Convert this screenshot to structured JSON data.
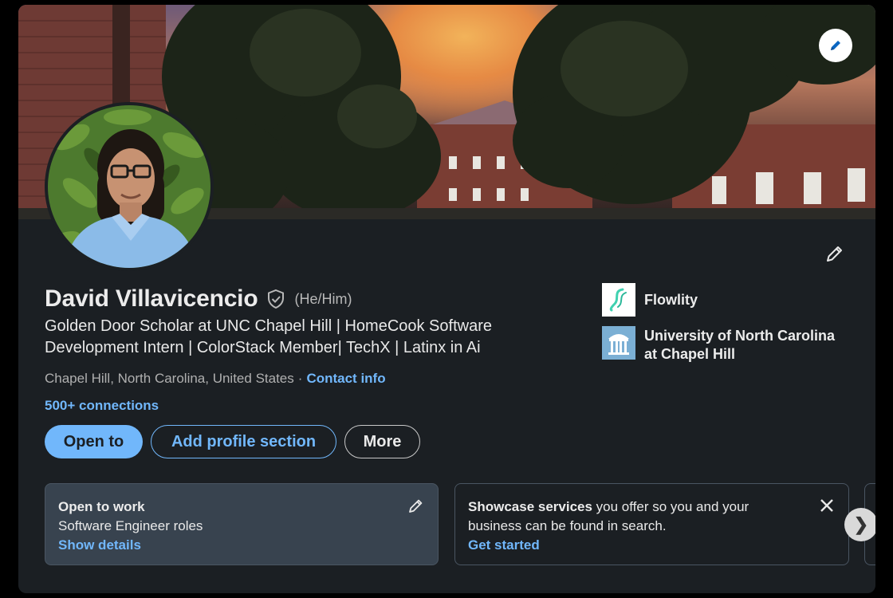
{
  "profile": {
    "name": "David Villavicencio",
    "pronouns": "(He/Him)",
    "headline": "Golden Door Scholar at UNC Chapel Hill | HomeCook Software Development Intern | ColorStack Member| TechX | Latinx in Ai",
    "location": "Chapel Hill, North Carolina, United States",
    "location_separator": "·",
    "contact_label": "Contact info",
    "connections": "500+ connections"
  },
  "actions": {
    "open_to": "Open to",
    "add_section": "Add profile section",
    "more": "More"
  },
  "organizations": [
    {
      "name": "Flowlity",
      "icon": "flowlity-logo"
    },
    {
      "name": "University of North Carolina at Chapel Hill",
      "icon": "unc-logo"
    }
  ],
  "open_to_work": {
    "title": "Open to work",
    "roles": "Software Engineer roles",
    "link": "Show details"
  },
  "showcase": {
    "bold": "Showcase services",
    "text": " you offer so you and your business can be found in search.",
    "link": "Get started"
  },
  "icons": {
    "cover_edit": "pencil-icon",
    "intro_edit": "pencil-icon",
    "verified": "shield-check-icon",
    "close": "close-icon",
    "next": "chevron-right-icon"
  },
  "colors": {
    "accent": "#71b7fb",
    "card_bg": "#1b1f23",
    "panel_bg": "#38434f"
  }
}
